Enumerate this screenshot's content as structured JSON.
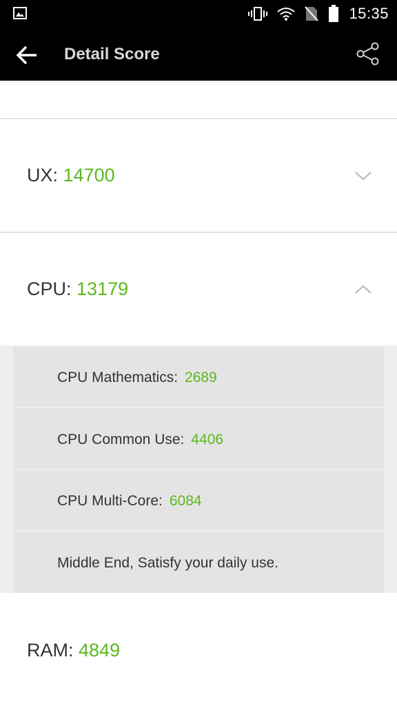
{
  "status_bar": {
    "time": "15:35",
    "icons": [
      "image-icon",
      "vibrate-icon",
      "wifi-icon",
      "no-sim-icon",
      "battery-icon"
    ]
  },
  "app_bar": {
    "title": "Detail Score",
    "back_icon": "back-arrow-icon",
    "share_icon": "share-icon"
  },
  "scores": {
    "ux": {
      "label": "UX:",
      "value": "14700"
    },
    "cpu": {
      "label": "CPU:",
      "value": "13179"
    },
    "ram": {
      "label": "RAM:",
      "value": "4849"
    }
  },
  "cpu_details": {
    "math": {
      "label": "CPU Mathematics:",
      "value": "2689"
    },
    "common": {
      "label": "CPU Common Use:",
      "value": "4406"
    },
    "multicore": {
      "label": "CPU Multi-Core:",
      "value": "6084"
    },
    "summary": "Middle End, Satisfy your daily use."
  },
  "colors": {
    "accent_green": "#5cb81e",
    "app_bar_bg": "#000000",
    "sub_panel_bg": "#eeeeee"
  }
}
